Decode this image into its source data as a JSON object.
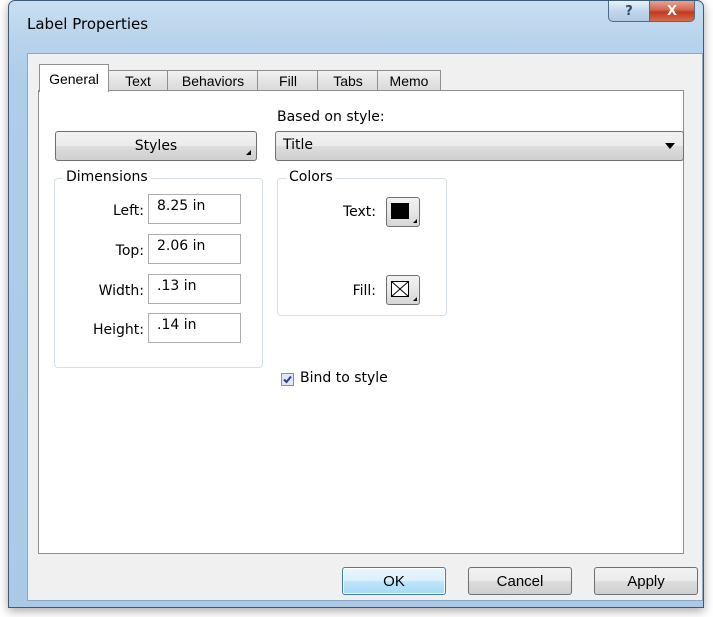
{
  "window": {
    "title": "Label Properties",
    "help_glyph": "?",
    "close_glyph": "X"
  },
  "tabs": [
    {
      "label": "General",
      "active": true
    },
    {
      "label": "Text"
    },
    {
      "label": "Behaviors"
    },
    {
      "label": "Fill"
    },
    {
      "label": "Tabs"
    },
    {
      "label": "Memo"
    }
  ],
  "general": {
    "styles_button": "Styles",
    "based_on_label": "Based on style:",
    "based_on_value": "Title",
    "dimensions": {
      "title": "Dimensions",
      "left_label": "Left:",
      "left_value": "8.25 in",
      "top_label": "Top:",
      "top_value": "2.06 in",
      "width_label": "Width:",
      "width_value": ".13 in",
      "height_label": "Height:",
      "height_value": ".14 in"
    },
    "colors": {
      "title": "Colors",
      "text_label": "Text:",
      "text_color": "#000000",
      "fill_label": "Fill:",
      "fill_color": "none"
    },
    "bind_to_style": {
      "label": "Bind to style",
      "checked": true
    }
  },
  "buttons": {
    "ok": "OK",
    "cancel": "Cancel",
    "apply": "Apply"
  }
}
